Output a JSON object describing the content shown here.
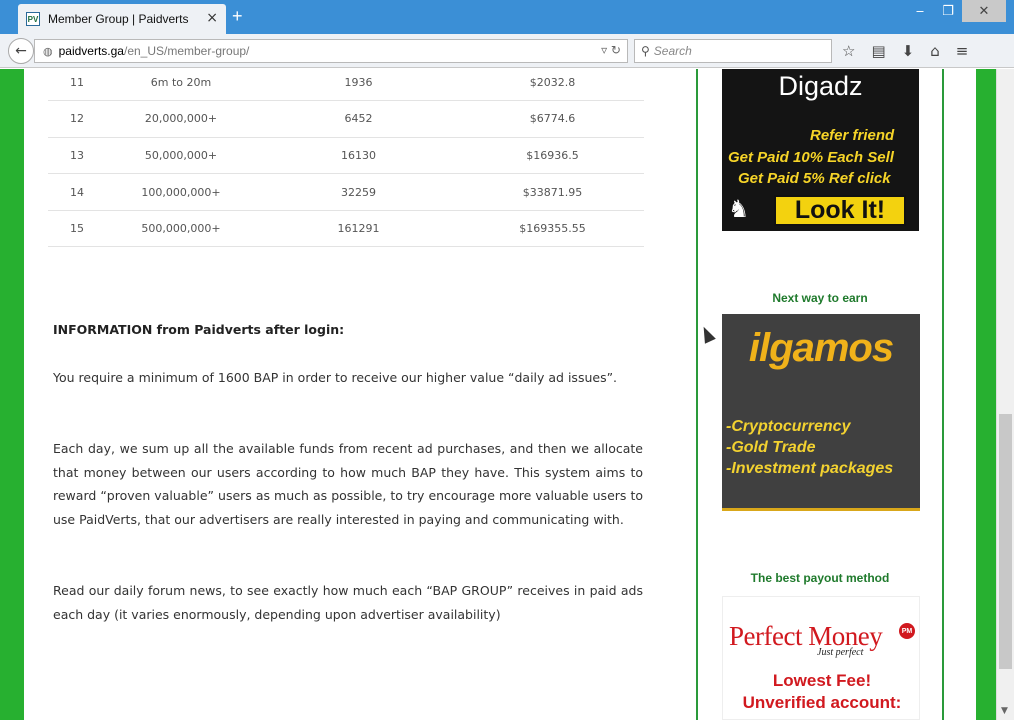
{
  "browser": {
    "tab_title": "Member Group | Paidverts",
    "favicon_text": "PV",
    "url_domain": "paidverts.ga",
    "url_path": "/en_US/member-group/",
    "search_placeholder": "Search",
    "colors": {
      "titlebar": "#3b8fd6",
      "page_border": "#27b030"
    }
  },
  "table": {
    "rows": [
      {
        "group": "11",
        "ads": "6m to 20m",
        "bap": "1936",
        "value": "$2032.8"
      },
      {
        "group": "12",
        "ads": "20,000,000+",
        "bap": "6452",
        "value": "$6774.6"
      },
      {
        "group": "13",
        "ads": "50,000,000+",
        "bap": "16130",
        "value": "$16936.5"
      },
      {
        "group": "14",
        "ads": "100,000,000+",
        "bap": "32259",
        "value": "$33871.95"
      },
      {
        "group": "15",
        "ads": "500,000,000+",
        "bap": "161291",
        "value": "$169355.55"
      }
    ]
  },
  "info": {
    "title": "INFORMATION from Paidverts after login:",
    "p1": "You require a minimum of 1600 BAP in order to receive our higher value “daily ad issues”.",
    "p2": "Each day, we sum up all the available funds from recent ad purchases, and then we allocate that money between our users according to how much BAP they have. This system aims to reward “proven valuable” users as much as possible, to try  encourage more valuable users to use PaidVerts, that our advertisers are really interested in paying and communicating with.",
    "p3": "Read our daily forum news, to see exactly how much each “BAP GROUP” receives in paid ads each day (it varies enormously, depending upon advertiser availability)"
  },
  "sidebar": {
    "ad1": {
      "brand": "Digadz",
      "line1": "Refer friend",
      "line2": "Get Paid 10% Each Sell",
      "line3": "Get Paid 5% Ref click",
      "cta": "Look It!"
    },
    "heading2": "Next way to earn",
    "ad2": {
      "brand": "ilgamos",
      "item1": "-Cryptocurrency",
      "item2": "-Gold Trade",
      "item3": "-Investment packages"
    },
    "heading3": "The best payout method",
    "ad3": {
      "brand": "Perfect Money",
      "badge": "PM",
      "tagline": "Just perfect",
      "line1": "Lowest Fee!",
      "line2": "Unverified account:"
    }
  }
}
